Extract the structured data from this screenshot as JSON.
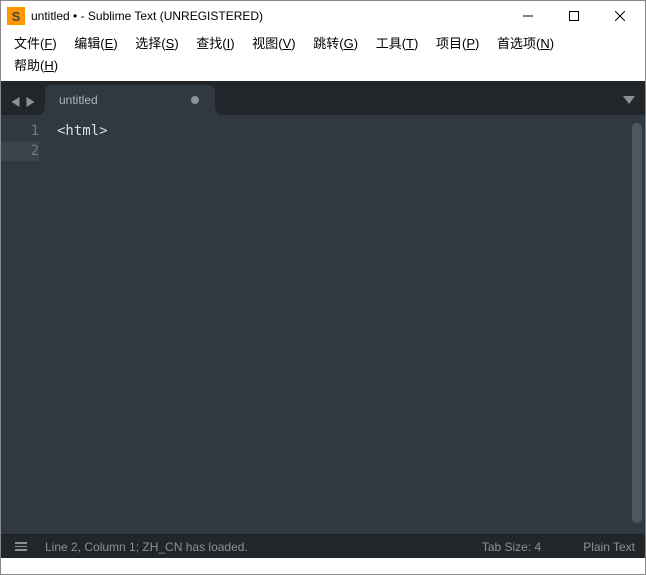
{
  "titlebar": {
    "icon_letter": "S",
    "title": "untitled • - Sublime Text (UNREGISTERED)"
  },
  "menu": {
    "file": {
      "label": "文件",
      "key": "F"
    },
    "edit": {
      "label": "编辑",
      "key": "E"
    },
    "select": {
      "label": "选择",
      "key": "S"
    },
    "find": {
      "label": "查找",
      "key": "I"
    },
    "view": {
      "label": "视图",
      "key": "V"
    },
    "goto": {
      "label": "跳转",
      "key": "G"
    },
    "tools": {
      "label": "工具",
      "key": "T"
    },
    "project": {
      "label": "项目",
      "key": "P"
    },
    "prefs": {
      "label": "首选项",
      "key": "N"
    },
    "help": {
      "label": "帮助",
      "key": "H"
    }
  },
  "tabs": {
    "items": [
      {
        "label": "untitled",
        "dirty": true
      }
    ]
  },
  "editor": {
    "gutter": [
      "1",
      "2"
    ],
    "lines": [
      "<html>",
      ""
    ],
    "active_line": 2
  },
  "statusbar": {
    "position": "Line 2, Column 1; ZH_CN has loaded.",
    "tab_size": "Tab Size: 4",
    "syntax": "Plain Text"
  }
}
